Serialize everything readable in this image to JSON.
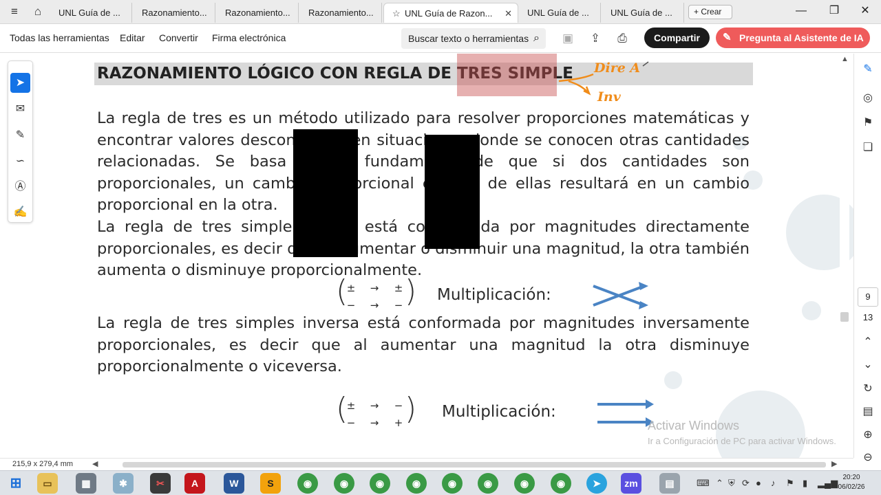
{
  "browser": {
    "tabs": [
      {
        "label": "UNL Guía de ...",
        "active": false
      },
      {
        "label": "Razonamiento...",
        "active": false
      },
      {
        "label": "Razonamiento...",
        "active": false
      },
      {
        "label": "Razonamiento...",
        "active": false
      },
      {
        "label": "UNL Guía de Razon...",
        "active": true
      },
      {
        "label": "UNL Guía de ...",
        "active": false
      },
      {
        "label": "UNL Guía de ...",
        "active": false
      }
    ],
    "new_tab_label": "Crear",
    "menu_icon": "≡",
    "home_icon": "⌂",
    "star_icon": "☆",
    "close_icon": "✕",
    "plus_icon": "+",
    "win_minimize": "—",
    "win_restore": "❐",
    "win_close": "✕"
  },
  "toolbar": {
    "menu": [
      "Todas las herramientas",
      "Editar",
      "Convertir",
      "Firma electrónica"
    ],
    "search_label": "Buscar texto o herramientas",
    "share_label": "Compartir",
    "ai_label": "Pregunta al Asistente de IA",
    "accent": "#1473e6",
    "ai_color": "#ef5b5b"
  },
  "document": {
    "title": "RAZONAMIENTO LÓGICO CON REGLA DE TRES SIMPLE",
    "annotation_direct": "Dire A",
    "annotation_inverse": "Inv",
    "p1": "La regla de tres es un método utilizado para resolver proporciones matemáticas y encontrar valores desconocidos en situaciones donde se conocen otras cantidades relacionadas. Se basa en el fundamento de que si dos cantidades son proporcionales, un cambio proporcional en una de ellas resultará en un cambio proporcional en la otra.",
    "p2": "La regla de tres simple directa está conformada por magnitudes directamente proporcionales, es decir que al aumentar o disminuir una magnitud, la otra también aumenta o disminuye proporcionalmente.",
    "p3": "La regla de tres simples inversa está conformada por magnitudes inversamente proporcionales, es decir que al aumentar una magnitud la otra disminuye proporcionalmente o viceversa.",
    "formula_direct": {
      "top": [
        "±",
        "→",
        "±"
      ],
      "bottom": [
        "−",
        "→",
        "−"
      ],
      "label": "Multiplicación:"
    },
    "formula_inverse": {
      "top": [
        "±",
        "→",
        "−"
      ],
      "bottom": [
        "−",
        "→",
        "+"
      ],
      "label": "Multiplicación:"
    },
    "watermark_line1": "Activar Windows",
    "watermark_line2": "Ir a Configuración de PC para activar Windows."
  },
  "viewer": {
    "page_current": "9",
    "page_total": "13",
    "page_size": "215,9 x 279,4 mm"
  },
  "taskbar": {
    "time": "20:20",
    "date": "06/02/26"
  }
}
